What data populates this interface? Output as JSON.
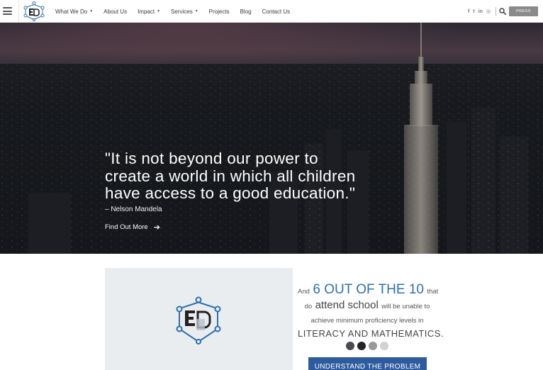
{
  "header": {
    "nav": [
      {
        "label": "What We Do",
        "has_dropdown": true
      },
      {
        "label": "About Us",
        "has_dropdown": false
      },
      {
        "label": "Impact",
        "has_dropdown": true
      },
      {
        "label": "Services",
        "has_dropdown": true
      },
      {
        "label": "Projects",
        "has_dropdown": false
      },
      {
        "label": "Blog",
        "has_dropdown": false
      },
      {
        "label": "Contact Us",
        "has_dropdown": false
      }
    ],
    "social": [
      {
        "icon": "facebook-icon",
        "glyph": "f"
      },
      {
        "icon": "twitter-icon",
        "glyph": "t"
      },
      {
        "icon": "linkedin-icon",
        "glyph": "in"
      },
      {
        "icon": "instagram-icon",
        "glyph": "◎"
      }
    ],
    "press_label": "PRESS"
  },
  "hero": {
    "quote": "\"It is not beyond our power to create a world in which all children have access to a good education.\"",
    "attribution": "– Nelson Mandela",
    "cta_label": "Find Out More",
    "cta_arrow": "➔"
  },
  "stat": {
    "p1": "And",
    "p2": "6 OUT OF THE 10",
    "p3": "that",
    "p4": "do",
    "p5": "attend school",
    "p6": "will be unable to",
    "p7": "achieve minimum proficiency levels in",
    "p8": "LITERACY AND MATHEMATICS."
  },
  "carousel_dots": [
    "#4a4a52",
    "#222226",
    "#9a9a9a",
    "#d2d2d2"
  ],
  "cta_button": "UNDERSTAND THE PROBLEM",
  "colors": {
    "accent_blue": "#2f6fb0",
    "button_blue": "#2e5a9e",
    "press_gray": "#8a8a8a"
  }
}
